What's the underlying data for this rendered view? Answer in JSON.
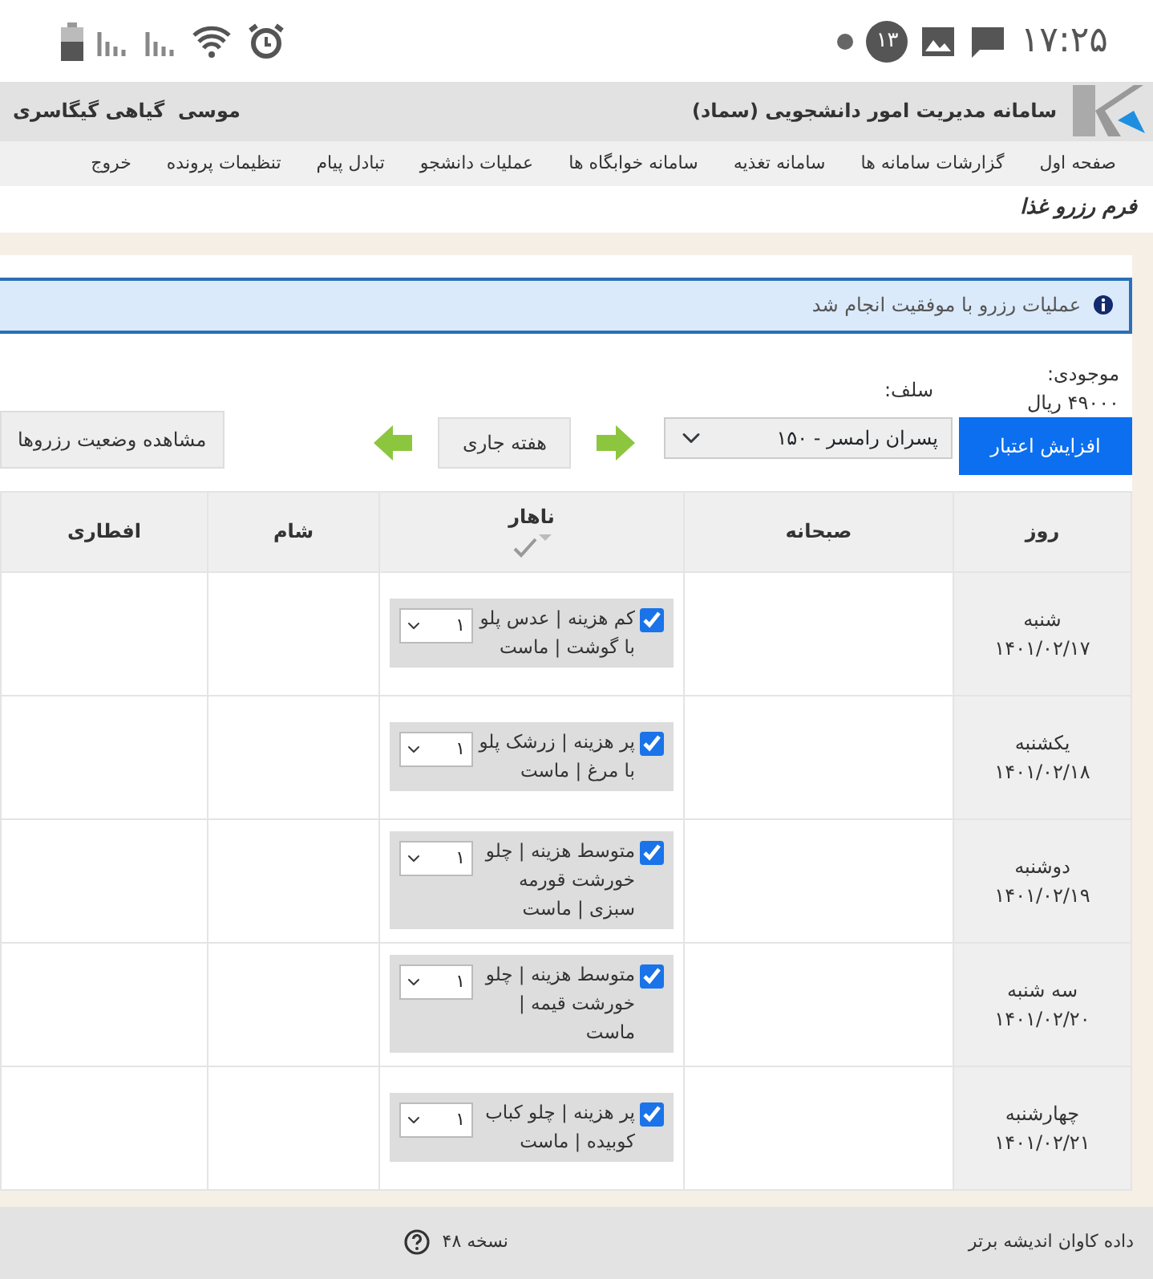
{
  "status_bar": {
    "time": "۱۷:۲۵",
    "notification_count": "۱۳"
  },
  "header": {
    "title": "سامانه مدیریت امور دانشجویی (سماد)",
    "user": "موسی  گیاهی گیگاسری"
  },
  "nav": [
    "صفحه اول",
    "گزارشات سامانه ها",
    "سامانه تغذیه",
    "سامانه خوابگاه ها",
    "عملیات دانشجو",
    "تبادل پیام",
    "تنظیمات پرونده",
    "خروج"
  ],
  "page_title": "فرم رزرو غذا",
  "alert": "عملیات رزرو با موفقیت انجام شد",
  "credit": {
    "label": "موجودی:",
    "amount": "۴۹۰۰۰ ریال"
  },
  "self": {
    "label": "سلف:",
    "value": "پسران رامسر - ۱۵۰"
  },
  "buttons": {
    "increase": "افزایش اعتبار",
    "current_week": "هفته جاری",
    "view_status": "مشاهده وضعیت رزروها"
  },
  "table": {
    "columns": [
      "روز",
      "صبحانه",
      "ناهار",
      "شام",
      "افطاری"
    ],
    "lunch_header_checked": true,
    "rows": [
      {
        "day": "شنبه",
        "date": "۱۴۰۱/۰۲/۱۷",
        "lunch": {
          "checked": true,
          "text": "کم هزینه | عدس پلو با گوشت | ماست",
          "count": "۱"
        }
      },
      {
        "day": "یکشنبه",
        "date": "۱۴۰۱/۰۲/۱۸",
        "lunch": {
          "checked": true,
          "text": "پر هزینه | زرشک پلو با مرغ | ماست",
          "count": "۱"
        }
      },
      {
        "day": "دوشنبه",
        "date": "۱۴۰۱/۰۲/۱۹",
        "lunch": {
          "checked": true,
          "text": "متوسط هزینه | چلو خورشت قورمه سبزی | ماست",
          "count": "۱"
        }
      },
      {
        "day": "سه شنبه",
        "date": "۱۴۰۱/۰۲/۲۰",
        "lunch": {
          "checked": true,
          "text": "متوسط هزینه | چلو خورشت قیمه | ماست",
          "count": "۱"
        }
      },
      {
        "day": "چهارشنبه",
        "date": "۱۴۰۱/۰۲/۲۱",
        "lunch": {
          "checked": true,
          "text": "پر هزینه | چلو کباب کوبیده | ماست",
          "count": "۱"
        }
      }
    ]
  },
  "footer": {
    "company": "داده کاوان اندیشه برتر",
    "version": "نسخه ۴۸"
  }
}
